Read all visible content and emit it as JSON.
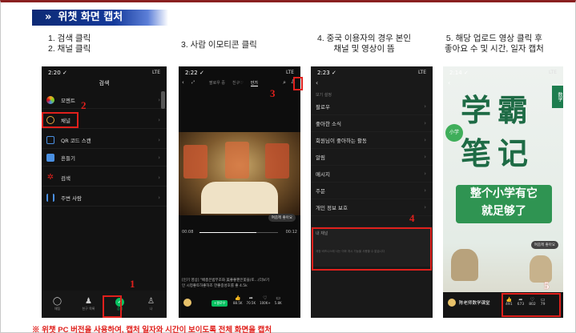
{
  "header": {
    "title": "위챗 화면 캡처",
    "chevron": "»"
  },
  "steps": {
    "s1_line1": "1. 검색 클릭",
    "s1_line2": "2. 채널 클릭",
    "s3": "3. 사람 이모티콘 클릭",
    "s4_line1": "4. 중국 이용자의 경우 본인",
    "s4_line2": "채널 및 영상이 뜸",
    "s5_line1": "5. 해당 업로드 영상 클릭 후",
    "s5_line2": "좋아요 수 및 시간, 일자 캡처"
  },
  "phone1": {
    "time": "2:20 ✓",
    "status": "LTE",
    "title": "검색",
    "items": [
      "모멘트",
      "채널",
      "QR 코드 스캔",
      "흔들기",
      "검색",
      "주변 사람"
    ],
    "nav": [
      "채팅",
      "친구 목록",
      "검색",
      "나"
    ],
    "markers": [
      "1",
      "2"
    ]
  },
  "phone2": {
    "time": "2:22 ✓",
    "status": "LTE",
    "tabs": [
      "팔로우 중",
      "친구♡",
      "인기"
    ],
    "time_start": "00:08",
    "time_end": "00:12",
    "caption1": "[인기 영상] \"배총은범부조화 美좋좋팬은쫓을(토...(더보기",
    "caption2": "인 시청좋토하좋하조 한좋중성호를 좋 4.5k",
    "counts": [
      "88.5K",
      "70.5K",
      "100K+",
      "5.8K"
    ],
    "follow": "+팔로우",
    "bubble": "여줌께 좋아요",
    "marker": "3"
  },
  "phone3": {
    "time": "2:23 ✓",
    "status": "LTE",
    "section": "보기 설정",
    "items": [
      "팔로우",
      "좋아한 소식",
      "회원님이 좋아하는 활동",
      "알림",
      "메시지",
      "주문",
      "개인 정보 보호"
    ],
    "channel_title": "내 채널",
    "channel_desc": "계정 비즈니스에 사는 이와 개시 기능을 사용할 수 없습니다",
    "marker": "4"
  },
  "phone4": {
    "time": "2:14 ✓",
    "status": "LTE",
    "chars1": "学霸",
    "chars2": "笔记",
    "small_tag": "小学",
    "slogan1": "整个小学有它",
    "slogan2": "就足够了",
    "channel": "陈老师数学课堂",
    "counts": [
      "491",
      "673",
      "802",
      "79"
    ],
    "bubble": "여줌께 좋아요",
    "side": "数学",
    "marker": "5"
  },
  "footer": "※ 위챗 PC 버전을 사용하여, 캡처 일자와 시간이 보이도록 전체 화면을 캡처",
  "colors": {
    "accent_red": "#e0201c",
    "header_blue": "#14399a",
    "wechat_green": "#07c160"
  }
}
